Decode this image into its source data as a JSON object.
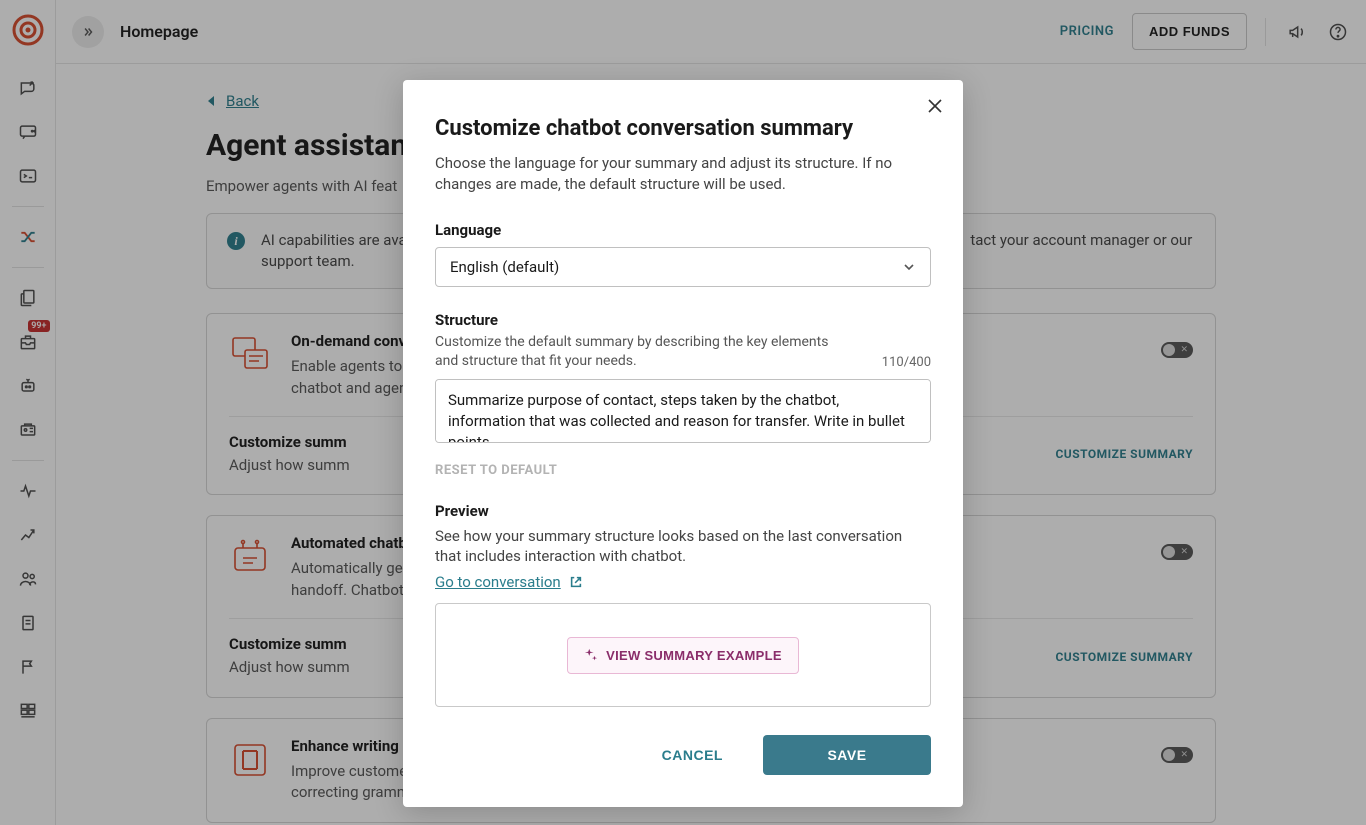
{
  "topbar": {
    "title": "Homepage",
    "pricing": "PRICING",
    "addFunds": "ADD FUNDS"
  },
  "rail": {
    "badge": "99+"
  },
  "page": {
    "back": "Back",
    "heading": "Agent assistant",
    "sub": "Empower agents with AI feat",
    "banner": "AI capabilities are avail... contact your account manager or our support team."
  },
  "cards": [
    {
      "title": "On-demand conv",
      "desc": "Enable agents to chatbot and agent",
      "subTitle": "Customize summ",
      "subDesc": "Adjust how summ",
      "action": "CUSTOMIZE SUMMARY"
    },
    {
      "title": "Automated chatb",
      "desc": "Automatically gen handoff. Chatbot",
      "subTitle": "Customize summ",
      "subDesc": "Adjust how summ",
      "action": "CUSTOMIZE SUMMARY"
    },
    {
      "title": "Enhance writing",
      "desc": "Improve customer correcting gramm"
    }
  ],
  "modal": {
    "title": "Customize chatbot conversation summary",
    "intro": "Choose the language for your summary and adjust its structure. If no changes are made, the default structure will be used.",
    "languageLabel": "Language",
    "languageValue": "English (default)",
    "structureLabel": "Structure",
    "structureHelp": "Customize the default summary by describing the key elements and structure that fit your needs.",
    "counter": "110/400",
    "textarea": "Summarize purpose of contact, steps taken by the chatbot, information that was collected and reason for transfer. Write in bullet points.",
    "reset": "RESET TO DEFAULT",
    "previewLabel": "Preview",
    "previewHelp": "See how your summary structure looks based on the last conversation that includes interaction with chatbot.",
    "gotoConv": "Go to conversation",
    "viewExample": "VIEW SUMMARY EXAMPLE",
    "cancel": "CANCEL",
    "save": "SAVE"
  }
}
